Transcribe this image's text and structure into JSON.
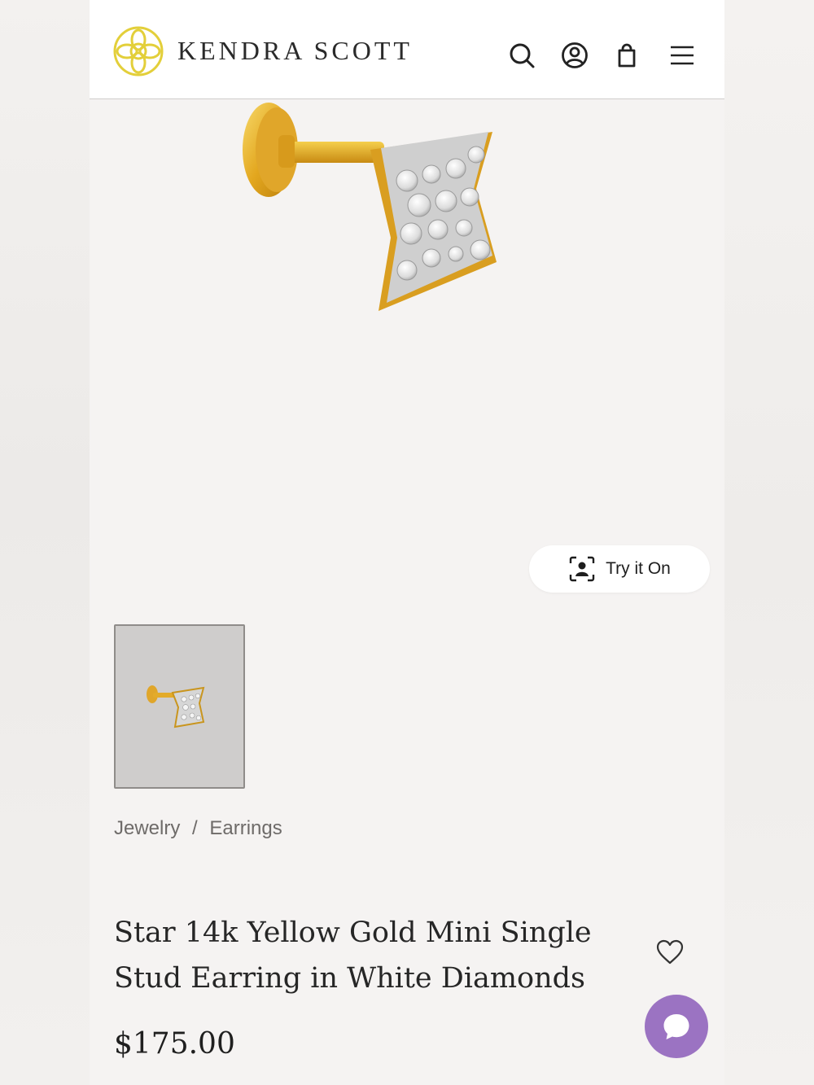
{
  "header": {
    "brand": "KENDRA SCOTT",
    "icons": [
      "search-icon",
      "account-icon",
      "bag-icon",
      "menu-icon"
    ]
  },
  "gallery": {
    "try_on_label": "Try it On"
  },
  "breadcrumb": {
    "items": [
      "Jewelry",
      "Earrings"
    ],
    "separator": "/"
  },
  "product": {
    "title": "Star 14k Yellow Gold Mini Single Stud Earring in White Diamonds",
    "price": "$175.00"
  },
  "colors": {
    "brand_gold": "#e3cf3a",
    "chat_purple": "#9b73c2",
    "background": "#f5f3f2",
    "header_bg": "#ffffff"
  }
}
